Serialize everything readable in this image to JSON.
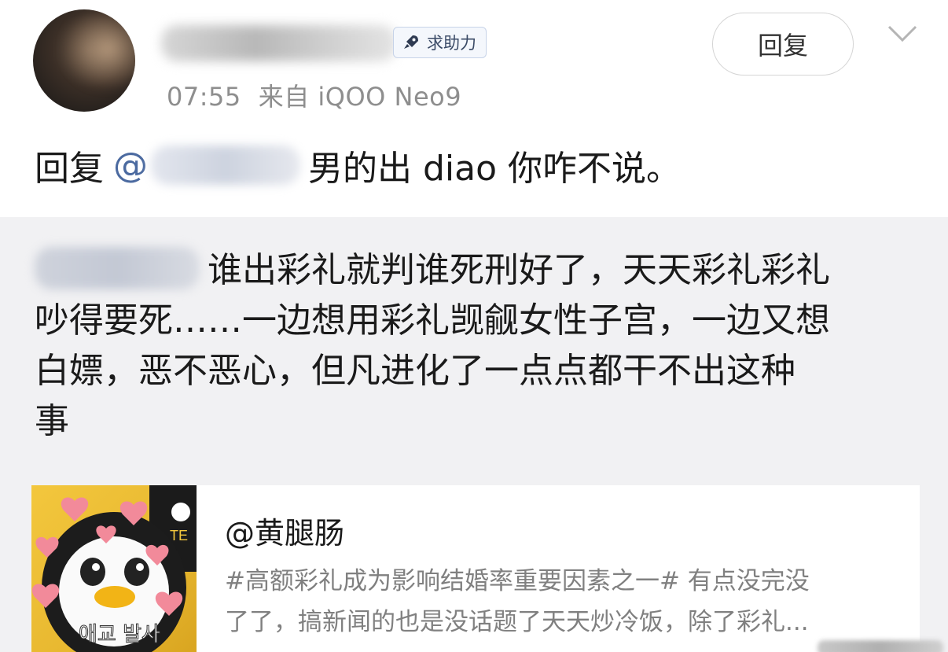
{
  "post": {
    "badge_label": "求助力",
    "time": "07:55",
    "source": "来自 iQOO Neo9",
    "reply_button": "回复",
    "reply_prefix": "回复",
    "reply_at": "@",
    "reply_text": "男的出 diao 你咋不说。"
  },
  "quote": {
    "lines": [
      "谁出彩礼就判谁死刑好了，天天彩礼彩礼",
      "吵得要死……一边想用彩礼觊觎女性子宫，一边又想",
      "白嫖，恶不恶心，但凡进化了一点点都干不出这种",
      "事"
    ]
  },
  "card": {
    "title": "@黄腿肠",
    "desc_line1": "#高额彩礼成为影响结婚率重要因素之一# 有点没完没",
    "desc_line2": "了了，搞新闻的也是没话题了天天炒冷饭，除了彩礼...",
    "thumb_caption": "애교 발사",
    "thumb_side": "TE"
  },
  "colors": {
    "quote_background": "#f1f1f3",
    "meta_text": "#8e8e8e",
    "thumbnail_yellow": "#f3c73d",
    "heart_pink": "#f28a9a"
  },
  "icons": [
    "rocket-icon",
    "chevron-down-icon"
  ]
}
